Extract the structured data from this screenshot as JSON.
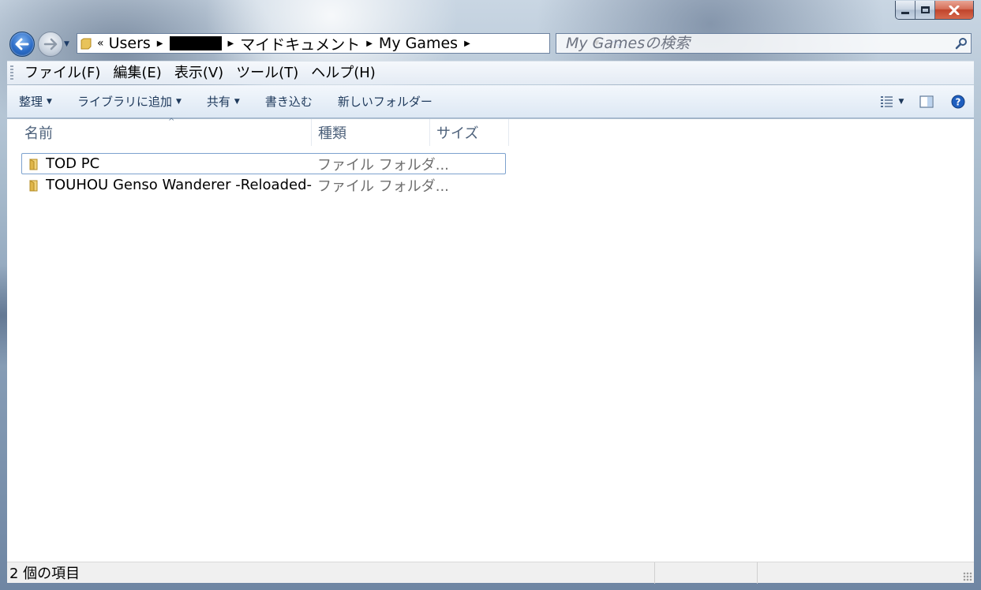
{
  "window": {
    "caption_buttons": {
      "minimize": "minimize",
      "maximize": "maximize",
      "close": "close"
    }
  },
  "nav": {
    "address": {
      "overflow_chevron": "«",
      "crumbs": [
        "Users",
        "",
        "マイドキュメント",
        "My Games"
      ],
      "redacted_crumb_index": 1
    },
    "search": {
      "placeholder": "My Gamesの検索"
    }
  },
  "menu": {
    "items": [
      "ファイル(F)",
      "編集(E)",
      "表示(V)",
      "ツール(T)",
      "ヘルプ(H)"
    ]
  },
  "commands": {
    "organize": "整理",
    "add_to_library": "ライブラリに追加",
    "share": "共有",
    "burn": "書き込む",
    "new_folder": "新しいフォルダー"
  },
  "columns": {
    "name": "名前",
    "type": "種類",
    "size": "サイズ"
  },
  "files": [
    {
      "name": "TOD PC",
      "type": "ファイル フォルダ...",
      "focused": true
    },
    {
      "name": "TOUHOU Genso Wanderer -Reloaded-",
      "type": "ファイル フォルダ...",
      "focused": false
    }
  ],
  "status": {
    "item_count": "2 個の項目"
  },
  "colors": {
    "accent": "#2c6cc7",
    "focus_border": "#7da2ce",
    "close_button": "#c0442b"
  }
}
